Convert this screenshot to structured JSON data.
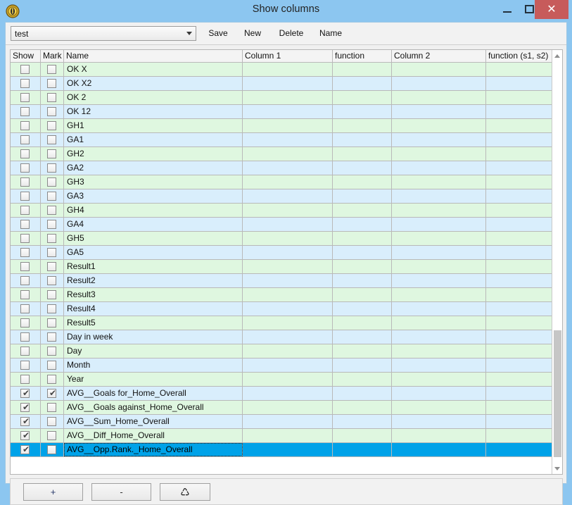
{
  "window": {
    "title": "Show columns",
    "icon": "coin-badge-icon",
    "controls": {
      "minimize": "minimize-icon",
      "maximize": "maximize-icon",
      "close": "✕"
    }
  },
  "toolbar": {
    "profile_value": "test",
    "profile_placeholder": "test",
    "save_label": "Save",
    "new_label": "New",
    "delete_label": "Delete",
    "name_label": "Name"
  },
  "grid": {
    "headers": [
      "Show",
      "Mark",
      "Name",
      "Column 1",
      "function",
      "Column 2",
      "function (s1, s2)"
    ],
    "rows": [
      {
        "show": false,
        "mark": false,
        "name": "OK X",
        "col1": "",
        "fn1": "",
        "col2": "",
        "fn2": "",
        "selected": false
      },
      {
        "show": false,
        "mark": false,
        "name": "OK X2",
        "col1": "",
        "fn1": "",
        "col2": "",
        "fn2": "",
        "selected": false
      },
      {
        "show": false,
        "mark": false,
        "name": "OK 2",
        "col1": "",
        "fn1": "",
        "col2": "",
        "fn2": "",
        "selected": false
      },
      {
        "show": false,
        "mark": false,
        "name": "OK 12",
        "col1": "",
        "fn1": "",
        "col2": "",
        "fn2": "",
        "selected": false
      },
      {
        "show": false,
        "mark": false,
        "name": "GH1",
        "col1": "",
        "fn1": "",
        "col2": "",
        "fn2": "",
        "selected": false
      },
      {
        "show": false,
        "mark": false,
        "name": "GA1",
        "col1": "",
        "fn1": "",
        "col2": "",
        "fn2": "",
        "selected": false
      },
      {
        "show": false,
        "mark": false,
        "name": "GH2",
        "col1": "",
        "fn1": "",
        "col2": "",
        "fn2": "",
        "selected": false
      },
      {
        "show": false,
        "mark": false,
        "name": "GA2",
        "col1": "",
        "fn1": "",
        "col2": "",
        "fn2": "",
        "selected": false
      },
      {
        "show": false,
        "mark": false,
        "name": "GH3",
        "col1": "",
        "fn1": "",
        "col2": "",
        "fn2": "",
        "selected": false
      },
      {
        "show": false,
        "mark": false,
        "name": "GA3",
        "col1": "",
        "fn1": "",
        "col2": "",
        "fn2": "",
        "selected": false
      },
      {
        "show": false,
        "mark": false,
        "name": "GH4",
        "col1": "",
        "fn1": "",
        "col2": "",
        "fn2": "",
        "selected": false
      },
      {
        "show": false,
        "mark": false,
        "name": "GA4",
        "col1": "",
        "fn1": "",
        "col2": "",
        "fn2": "",
        "selected": false
      },
      {
        "show": false,
        "mark": false,
        "name": "GH5",
        "col1": "",
        "fn1": "",
        "col2": "",
        "fn2": "",
        "selected": false
      },
      {
        "show": false,
        "mark": false,
        "name": "GA5",
        "col1": "",
        "fn1": "",
        "col2": "",
        "fn2": "",
        "selected": false
      },
      {
        "show": false,
        "mark": false,
        "name": "Result1",
        "col1": "",
        "fn1": "",
        "col2": "",
        "fn2": "",
        "selected": false
      },
      {
        "show": false,
        "mark": false,
        "name": "Result2",
        "col1": "",
        "fn1": "",
        "col2": "",
        "fn2": "",
        "selected": false
      },
      {
        "show": false,
        "mark": false,
        "name": "Result3",
        "col1": "",
        "fn1": "",
        "col2": "",
        "fn2": "",
        "selected": false
      },
      {
        "show": false,
        "mark": false,
        "name": "Result4",
        "col1": "",
        "fn1": "",
        "col2": "",
        "fn2": "",
        "selected": false
      },
      {
        "show": false,
        "mark": false,
        "name": "Result5",
        "col1": "",
        "fn1": "",
        "col2": "",
        "fn2": "",
        "selected": false
      },
      {
        "show": false,
        "mark": false,
        "name": "Day in week",
        "col1": "",
        "fn1": "",
        "col2": "",
        "fn2": "",
        "selected": false
      },
      {
        "show": false,
        "mark": false,
        "name": "Day",
        "col1": "",
        "fn1": "",
        "col2": "",
        "fn2": "",
        "selected": false
      },
      {
        "show": false,
        "mark": false,
        "name": "Month",
        "col1": "",
        "fn1": "",
        "col2": "",
        "fn2": "",
        "selected": false
      },
      {
        "show": false,
        "mark": false,
        "name": "Year",
        "col1": "",
        "fn1": "",
        "col2": "",
        "fn2": "",
        "selected": false
      },
      {
        "show": true,
        "mark": true,
        "name": "AVG__Goals for_Home_Overall",
        "col1": "",
        "fn1": "",
        "col2": "",
        "fn2": "",
        "selected": false
      },
      {
        "show": true,
        "mark": false,
        "name": "AVG__Goals against_Home_Overall",
        "col1": "",
        "fn1": "",
        "col2": "",
        "fn2": "",
        "selected": false
      },
      {
        "show": true,
        "mark": false,
        "name": "AVG__Sum_Home_Overall",
        "col1": "",
        "fn1": "",
        "col2": "",
        "fn2": "",
        "selected": false
      },
      {
        "show": true,
        "mark": false,
        "name": "AVG__Diff_Home_Overall",
        "col1": "",
        "fn1": "",
        "col2": "",
        "fn2": "",
        "selected": false
      },
      {
        "show": true,
        "mark": false,
        "name": "AVG__Opp.Rank._Home_Overall",
        "col1": "",
        "fn1": "",
        "col2": "",
        "fn2": "",
        "selected": true
      }
    ],
    "scrollbar": {
      "up_icon": "scroll-up-arrow-icon",
      "down_icon": "scroll-down-arrow-icon"
    }
  },
  "footer": {
    "add_label": "+",
    "remove_label": "-",
    "refresh_icon": "♺"
  },
  "colors": {
    "titlebar": "#8CC6F0",
    "close_button": "#C75B5B",
    "row_even": "#DFF7E0",
    "row_odd": "#D9EEFC",
    "selection": "#00A2E8",
    "panel": "#F2F2F2"
  }
}
